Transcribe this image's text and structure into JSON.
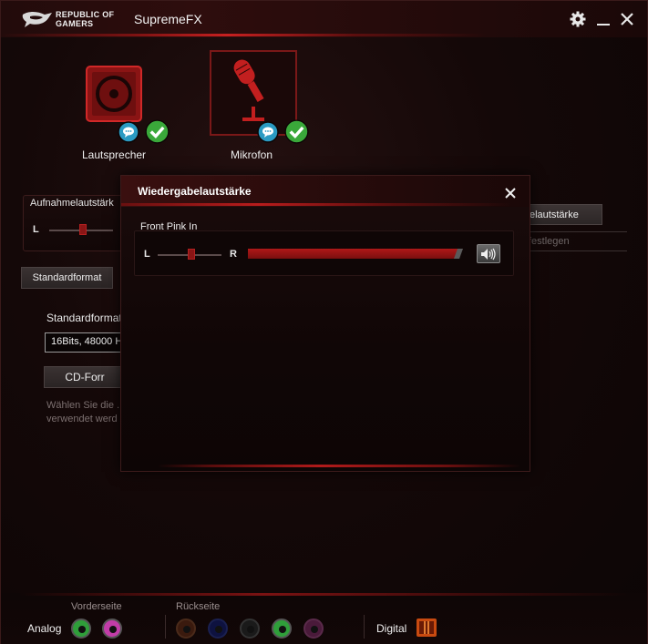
{
  "app": {
    "brand_line1": "REPUBLIC OF",
    "brand_line2": "GAMERS",
    "title": "SupremeFX"
  },
  "devices": [
    {
      "label": "Lautsprecher",
      "icon": "speaker-icon"
    },
    {
      "label": "Mikrofon",
      "icon": "microphone-icon"
    }
  ],
  "recording_panel": {
    "title": "Aufnahmelautstärk",
    "left": "L"
  },
  "default_format": {
    "tab_label": "Standardformat",
    "section_label": "Standardformat",
    "selected_value": "16Bits, 48000 H",
    "cd_button": "CD-Forr",
    "description_line1": "Wählen Sie die ...",
    "description_line2": "verwendet werd"
  },
  "right_partial": {
    "button_label": "elautstärke",
    "field_text": "festlegen"
  },
  "dialog": {
    "title": "Wiedergabelautstärke",
    "channel_label": "Front Pink In",
    "left": "L",
    "right": "R",
    "balance": 0.5,
    "volume": 1.0
  },
  "bottom": {
    "analog_label": "Analog",
    "front_label": "Vorderseite",
    "rear_label": "Rückseite",
    "digital_label": "Digital",
    "front_jacks": [
      "#2f9e3a",
      "#c23ca8"
    ],
    "rear_jacks": [
      "#7a3a1a",
      "#1a2a8a",
      "#2a2a2a",
      "#2f9e3a",
      "#8a2a6a"
    ]
  },
  "colors": {
    "accent": "#c21f1f",
    "check_green": "#3aa83a",
    "chat_blue": "#2a9ac2"
  }
}
